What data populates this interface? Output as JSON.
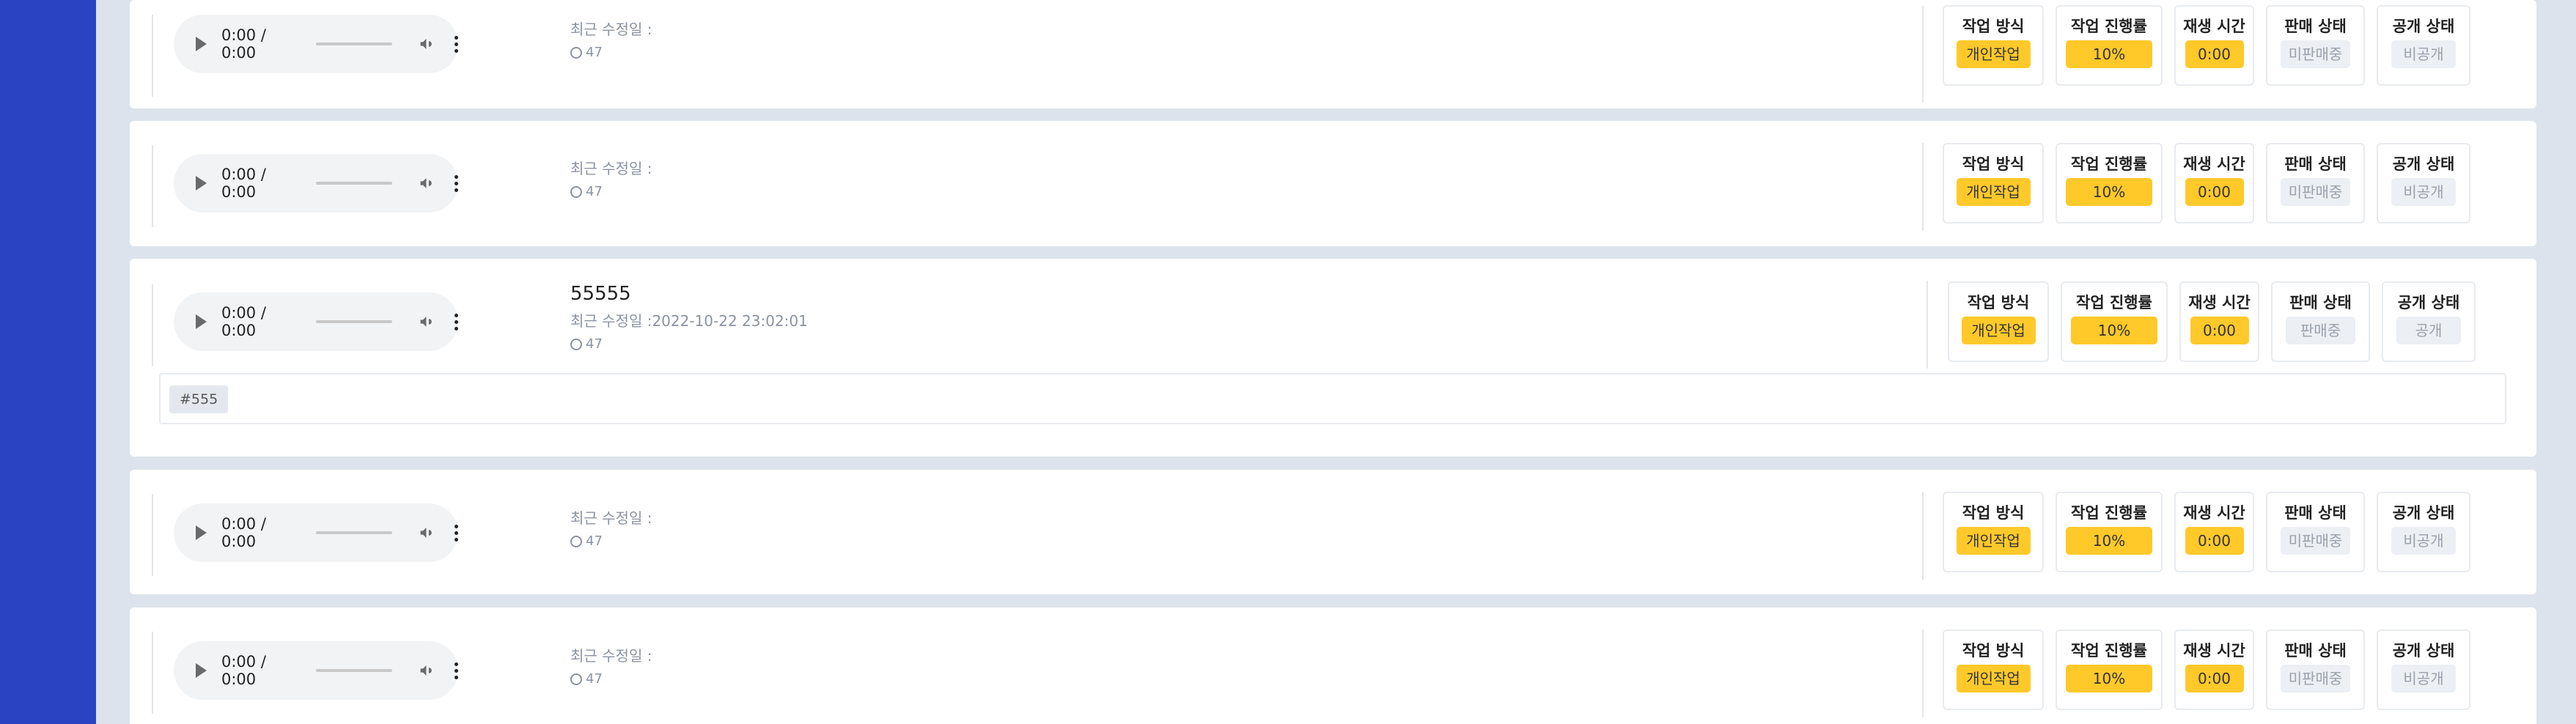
{
  "colors": {
    "sidebar": "#2a43c2",
    "accent_yellow": "#ffc92a",
    "background": "#dde3ec"
  },
  "items": [
    {
      "title": "",
      "modified_label": "최근 수정일 :",
      "modified_date": "",
      "views": "47",
      "audio": {
        "time": "0:00 / 0:00"
      },
      "status": [
        {
          "label": "작업 방식",
          "value": "개인작업",
          "tone": "yellow"
        },
        {
          "label": "작업 진행률",
          "value": "10%",
          "tone": "yellow"
        },
        {
          "label": "재생 시간",
          "value": "0:00",
          "tone": "yellow"
        },
        {
          "label": "판매 상태",
          "value": "미판매중",
          "tone": "gray"
        },
        {
          "label": "공개 상태",
          "value": "비공개",
          "tone": "gray"
        }
      ]
    },
    {
      "title": "",
      "modified_label": "최근 수정일 :",
      "modified_date": "",
      "views": "47",
      "audio": {
        "time": "0:00 / 0:00"
      },
      "status": [
        {
          "label": "작업 방식",
          "value": "개인작업",
          "tone": "yellow"
        },
        {
          "label": "작업 진행률",
          "value": "10%",
          "tone": "yellow"
        },
        {
          "label": "재생 시간",
          "value": "0:00",
          "tone": "yellow"
        },
        {
          "label": "판매 상태",
          "value": "미판매중",
          "tone": "gray"
        },
        {
          "label": "공개 상태",
          "value": "비공개",
          "tone": "gray"
        }
      ]
    },
    {
      "title": "55555",
      "modified_label": "최근 수정일 :",
      "modified_date": "2022-10-22 23:02:01",
      "views": "47",
      "audio": {
        "time": "0:00 / 0:00"
      },
      "tags": [
        "#555"
      ],
      "status": [
        {
          "label": "작업 방식",
          "value": "개인작업",
          "tone": "yellow"
        },
        {
          "label": "작업 진행률",
          "value": "10%",
          "tone": "yellow"
        },
        {
          "label": "재생 시간",
          "value": "0:00",
          "tone": "yellow"
        },
        {
          "label": "판매 상태",
          "value": "판매중",
          "tone": "gray"
        },
        {
          "label": "공개 상태",
          "value": "공개",
          "tone": "gray"
        }
      ]
    },
    {
      "title": "",
      "modified_label": "최근 수정일 :",
      "modified_date": "",
      "views": "47",
      "audio": {
        "time": "0:00 / 0:00"
      },
      "status": [
        {
          "label": "작업 방식",
          "value": "개인작업",
          "tone": "yellow"
        },
        {
          "label": "작업 진행률",
          "value": "10%",
          "tone": "yellow"
        },
        {
          "label": "재생 시간",
          "value": "0:00",
          "tone": "yellow"
        },
        {
          "label": "판매 상태",
          "value": "미판매중",
          "tone": "gray"
        },
        {
          "label": "공개 상태",
          "value": "비공개",
          "tone": "gray"
        }
      ]
    },
    {
      "title": "",
      "modified_label": "최근 수정일 :",
      "modified_date": "",
      "views": "47",
      "audio": {
        "time": "0:00 / 0:00"
      },
      "status": [
        {
          "label": "작업 방식",
          "value": "개인작업",
          "tone": "yellow"
        },
        {
          "label": "작업 진행률",
          "value": "10%",
          "tone": "yellow"
        },
        {
          "label": "재생 시간",
          "value": "0:00",
          "tone": "yellow"
        },
        {
          "label": "판매 상태",
          "value": "미판매중",
          "tone": "gray"
        },
        {
          "label": "공개 상태",
          "value": "비공개",
          "tone": "gray"
        }
      ]
    }
  ]
}
